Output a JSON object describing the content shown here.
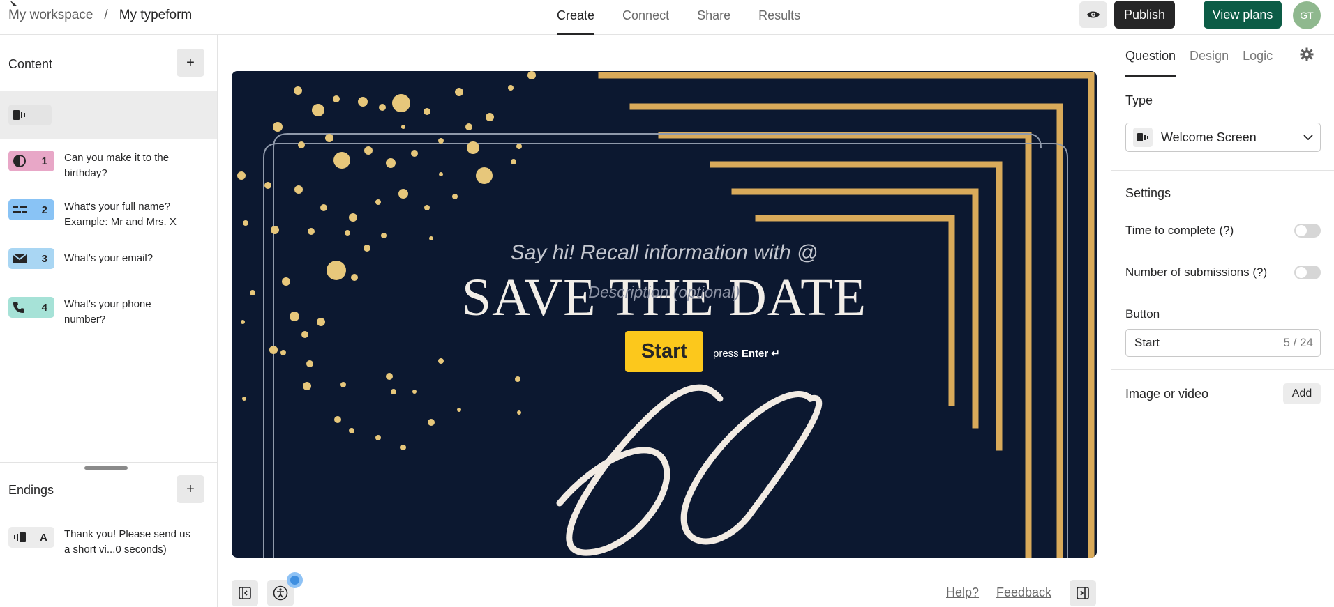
{
  "breadcrumb": {
    "workspace": "My workspace",
    "separator": "/",
    "form": "My typeform"
  },
  "nav": {
    "tabs": [
      "Create",
      "Connect",
      "Share",
      "Results"
    ],
    "active": "Create"
  },
  "header_actions": {
    "publish": "Publish",
    "view_plans": "View plans",
    "avatar_initials": "GT"
  },
  "sidebar": {
    "content_heading": "Content",
    "add_label": "+",
    "questions": [
      {
        "number": "",
        "text": "",
        "type": "welcome-screen",
        "color": "#ececec"
      },
      {
        "number": "1",
        "text": "Can you make it to the birthday?",
        "type": "yes-no",
        "color": "#e8a7c7"
      },
      {
        "number": "2",
        "text": "What's your full name? Example: Mr and Mrs. X",
        "type": "short-text",
        "color": "#89c3f5"
      },
      {
        "number": "3",
        "text": "What's your email?",
        "type": "email",
        "color": "#a9d6f3"
      },
      {
        "number": "4",
        "text": "What's your phone number?",
        "type": "phone",
        "color": "#a6e2d7"
      }
    ],
    "endings_heading": "Endings",
    "endings": [
      {
        "letter": "A",
        "text": "Thank you! Please send us a short vi...0 seconds)"
      }
    ]
  },
  "canvas": {
    "subtitle": "Say hi! Recall information with @",
    "title": "SAVE THE DATE",
    "description_placeholder": "Description (optional)",
    "start_button": "Start",
    "press_hint_prefix": "press",
    "press_hint_key": "Enter ↵",
    "big_number": "60"
  },
  "bottom": {
    "help": "Help?",
    "feedback": "Feedback"
  },
  "right_panel": {
    "tabs": [
      "Question",
      "Design",
      "Logic"
    ],
    "active_tab": "Question",
    "type_label": "Type",
    "type_value": "Welcome Screen",
    "settings_label": "Settings",
    "time_to_complete": "Time to complete (?)",
    "number_of_submissions": "Number of submissions (?)",
    "button_label": "Button",
    "button_value": "Start",
    "button_counter": "5 / 24",
    "image_or_video": "Image or video",
    "add_label": "Add"
  },
  "colors": {
    "canvas_bg": "#0c1830",
    "accent_yellow": "#fcc81c",
    "gold": "#d9aa5a",
    "plans_green": "#0c5c46"
  }
}
